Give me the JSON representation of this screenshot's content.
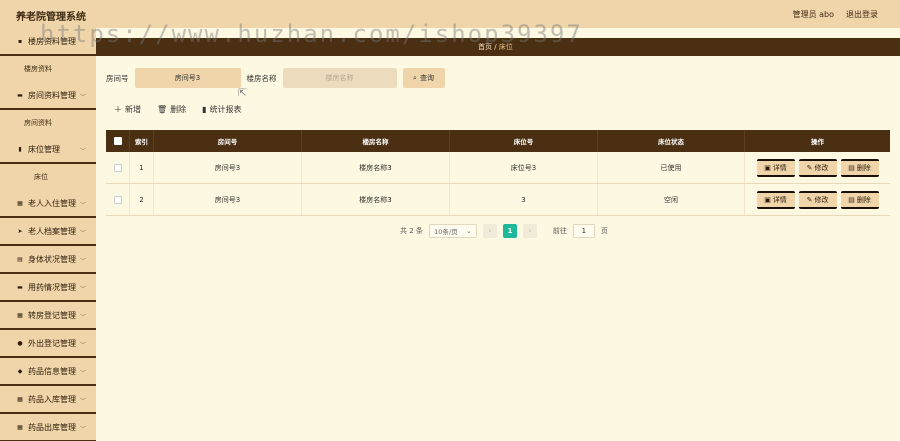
{
  "header": {
    "app_title": "养老院管理系统",
    "user_label": "管理员 abo",
    "logout_label": "退出登录"
  },
  "sidebar": {
    "items": [
      {
        "label": "楼房资料管理",
        "sub": "楼房资料"
      },
      {
        "label": "房间资料管理",
        "sub": "房间资料"
      },
      {
        "label": "床位管理",
        "sub": "床位"
      },
      {
        "label": "老人入住管理"
      },
      {
        "label": "老人档案管理"
      },
      {
        "label": "身体状况管理"
      },
      {
        "label": "用药情况管理"
      },
      {
        "label": "转房登记管理"
      },
      {
        "label": "外出登记管理"
      },
      {
        "label": "药品信息管理"
      },
      {
        "label": "药品入库管理"
      },
      {
        "label": "药品出库管理"
      }
    ]
  },
  "breadcrumb": {
    "home": "首页",
    "sep": "/",
    "current": "床位"
  },
  "search": {
    "room_label": "房间号",
    "room_value": "房间号3",
    "building_label": "楼房名称",
    "building_placeholder": "楼房名称",
    "button": "查询"
  },
  "actions": {
    "add": "新增",
    "delete": "删除",
    "report": "统计报表"
  },
  "table": {
    "headers": [
      "索引",
      "房间号",
      "楼房名称",
      "床位号",
      "床位状态",
      "操作"
    ],
    "rows": [
      {
        "index": "1",
        "room": "房间号3",
        "building": "楼房名称3",
        "bed": "床位号3",
        "status": "已使用"
      },
      {
        "index": "2",
        "room": "房间号3",
        "building": "楼房名称3",
        "bed": "3",
        "status": "空闲"
      }
    ],
    "ops": {
      "detail": "详情",
      "edit": "修改",
      "delete": "删除"
    }
  },
  "pagination": {
    "total": "共 2 条",
    "page_size": "10条/页",
    "current_page": "1",
    "goto_label": "前往",
    "goto_value": "1",
    "page_unit": "页"
  },
  "watermark": "https://www.huzhan.com/ishop39397"
}
